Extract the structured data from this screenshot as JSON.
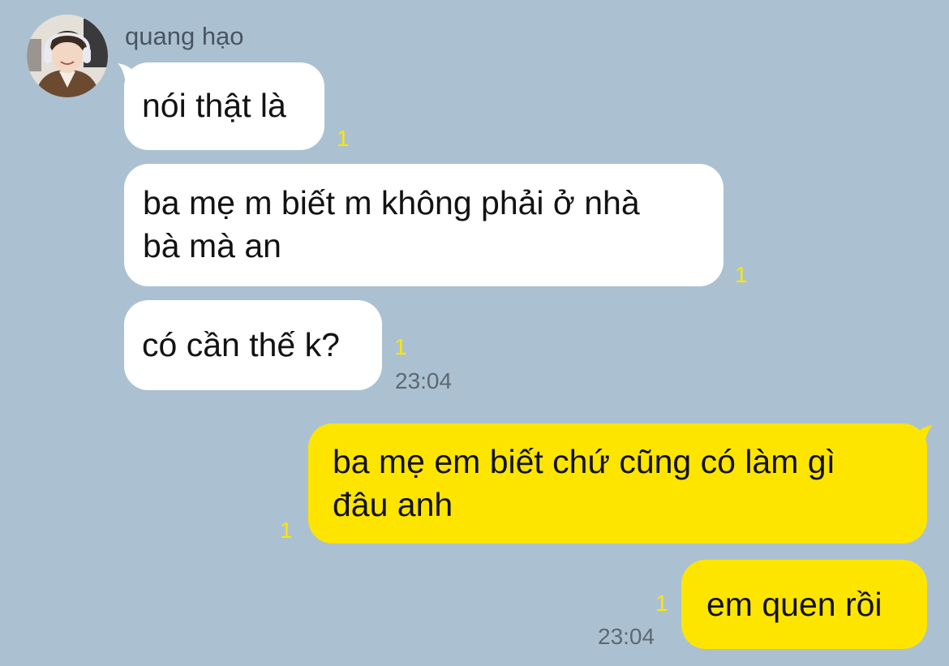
{
  "chat": {
    "sender_name": "quang hạo",
    "avatar_icon": "user-avatar-photo",
    "colors": {
      "background": "#abc1d1",
      "incoming_bubble": "#ffffff",
      "outgoing_bubble": "#fee500",
      "unread_count": "#fee500",
      "timestamp": "#5d6873"
    },
    "messages": [
      {
        "direction": "incoming",
        "text": "nói thật là",
        "unread": "1"
      },
      {
        "direction": "incoming",
        "text_line1": "ba mẹ m biết m không phải ở nhà",
        "text_line2": "bà mà an",
        "unread": "1"
      },
      {
        "direction": "incoming",
        "text": "có cần thế k?",
        "unread": "1",
        "time": "23:04"
      },
      {
        "direction": "outgoing",
        "text_line1": "ba mẹ em biết chứ cũng có làm gì",
        "text_line2": "đâu anh",
        "unread": "1"
      },
      {
        "direction": "outgoing",
        "text": "em quen rồi",
        "unread": "1",
        "time": "23:04"
      }
    ]
  }
}
